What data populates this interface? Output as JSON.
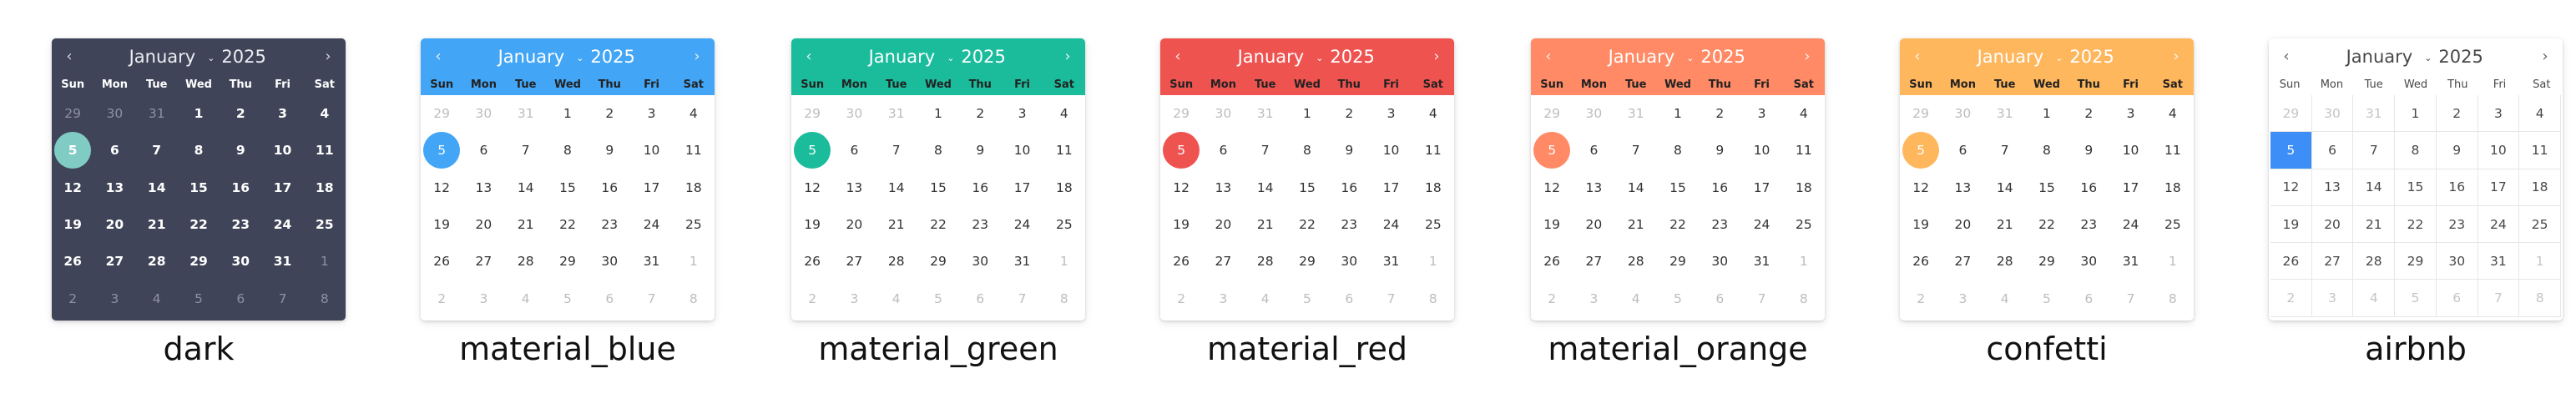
{
  "calendar": {
    "month": "January",
    "year": "2025",
    "prev_icon": "‹",
    "next_icon": "›",
    "caret_icon": "⌄",
    "weekdays": [
      "Sun",
      "Mon",
      "Tue",
      "Wed",
      "Thu",
      "Fri",
      "Sat"
    ],
    "days": [
      "29",
      "30",
      "31",
      "1",
      "2",
      "3",
      "4",
      "5",
      "6",
      "7",
      "8",
      "9",
      "10",
      "11",
      "12",
      "13",
      "14",
      "15",
      "16",
      "17",
      "18",
      "19",
      "20",
      "21",
      "22",
      "23",
      "24",
      "25",
      "26",
      "27",
      "28",
      "29",
      "30",
      "31",
      "1",
      "2",
      "3",
      "4",
      "5",
      "6",
      "7",
      "8"
    ],
    "other_month_indices": [
      0,
      1,
      2,
      34,
      35,
      36,
      37,
      38,
      39,
      40,
      41
    ],
    "selected_index": 7
  },
  "themes": [
    {
      "key": "dark",
      "label": "dark",
      "accent": "#80cbc4",
      "header": "#3f4458"
    },
    {
      "key": "blue",
      "label": "material_blue",
      "accent": "#42a5f5",
      "header": "#42a5f5"
    },
    {
      "key": "green",
      "label": "material_green",
      "accent": "#1abc9c",
      "header": "#1abc9c"
    },
    {
      "key": "red",
      "label": "material_red",
      "accent": "#ef5350",
      "header": "#ef5350"
    },
    {
      "key": "orange",
      "label": "material_orange",
      "accent": "#ff8a65",
      "header": "#ff8a65"
    },
    {
      "key": "confetti",
      "label": "confetti",
      "accent": "#ffb75e",
      "header": "#ffb75e"
    },
    {
      "key": "airbnb",
      "label": "airbnb",
      "accent": "#3e8ef7",
      "header": "#ffffff"
    }
  ]
}
